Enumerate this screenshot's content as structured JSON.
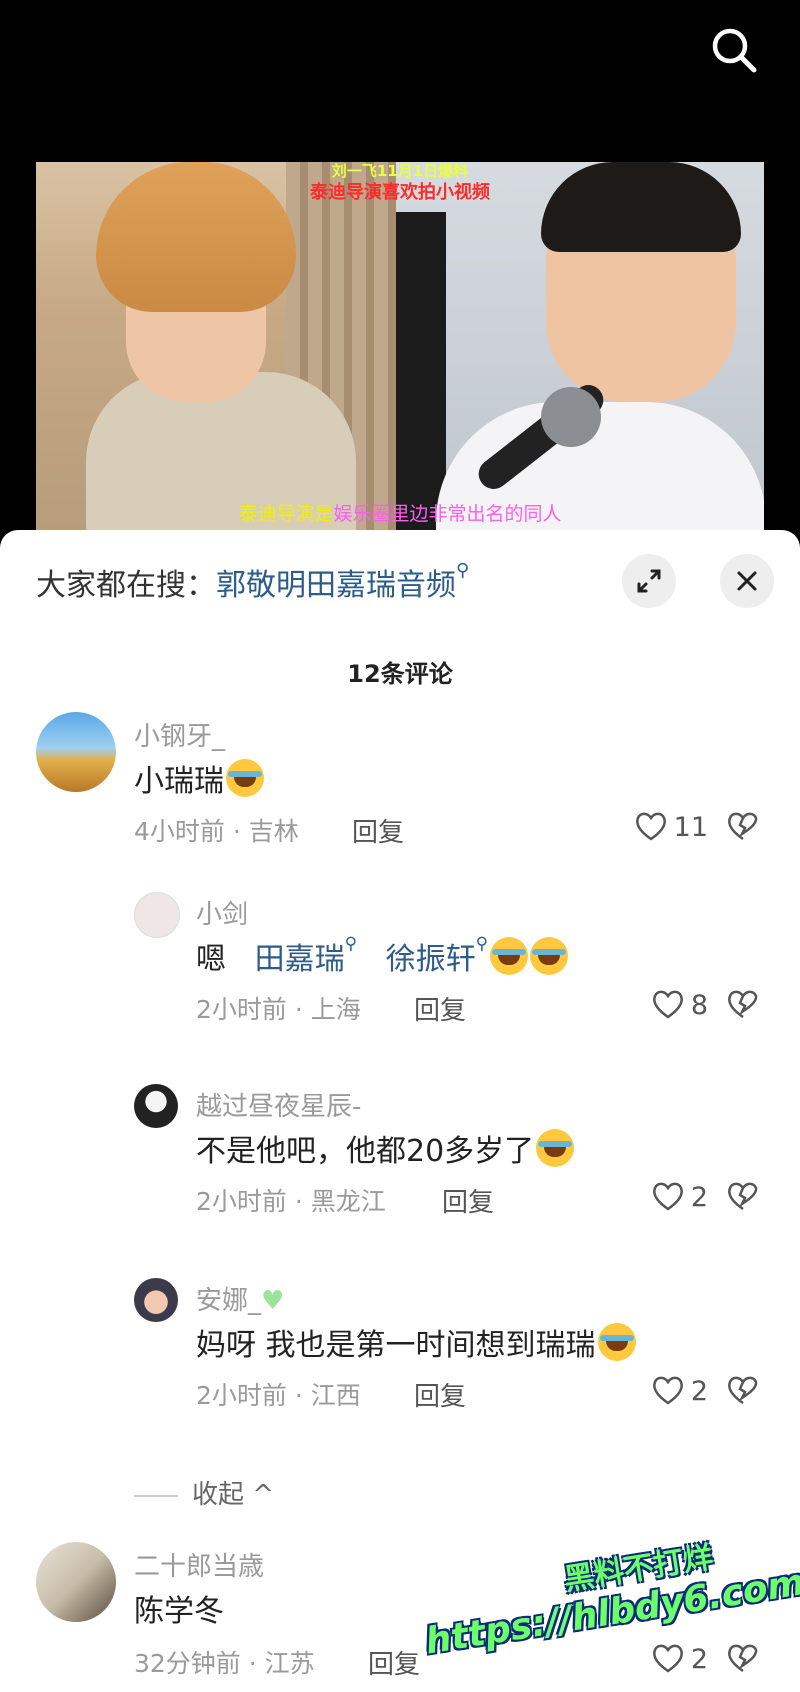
{
  "video": {
    "caption_top_line1": "刘一飞11月1日爆料",
    "caption_top_line2": "泰迪导演喜欢拍小视频",
    "caption_bottom_part1": "泰迪导演是",
    "caption_bottom_part2": "娱乐圈里边非常出名的同人"
  },
  "sheet": {
    "hot_search_label": "大家都在搜：",
    "hot_search_keyword": "郭敬明田嘉瑞音频",
    "comment_count": "12条评论",
    "collapse_label": "收起 ^"
  },
  "comments": [
    {
      "user": "小钢牙_",
      "text": "小瑞瑞",
      "time_loc": "4小时前 · 吉林",
      "reply": "回复",
      "likes": "11"
    },
    {
      "user": "小剑",
      "text_prefix": "嗯",
      "link1": "田嘉瑞",
      "link2": "徐振轩",
      "time_loc": "2小时前 · 上海",
      "reply": "回复",
      "likes": "8"
    },
    {
      "user": "越过昼夜星辰-",
      "text": "不是他吧，他都20多岁了",
      "time_loc": "2小时前 · 黑龙江",
      "reply": "回复",
      "likes": "2"
    },
    {
      "user": "安娜_",
      "text": "妈呀 我也是第一时间想到瑞瑞",
      "time_loc": "2小时前 · 江西",
      "reply": "回复",
      "likes": "2"
    },
    {
      "user": "二十郎当歳",
      "text": "陈学冬",
      "time_loc": "32分钟前 · 江苏",
      "reply": "回复",
      "likes": "2"
    }
  ],
  "watermark": {
    "line1": "黑料不打烊",
    "line2": "https://hlbdy6.com"
  },
  "icons": {
    "search": "search-icon",
    "expand": "expand-icon",
    "close": "close-icon",
    "like": "heart-icon",
    "dislike": "broken-heart-icon"
  },
  "colors": {
    "link": "#2e5c8a",
    "muted": "#9a9a9a",
    "sheet_bg": "#ffffff",
    "top_bg": "#000000"
  }
}
